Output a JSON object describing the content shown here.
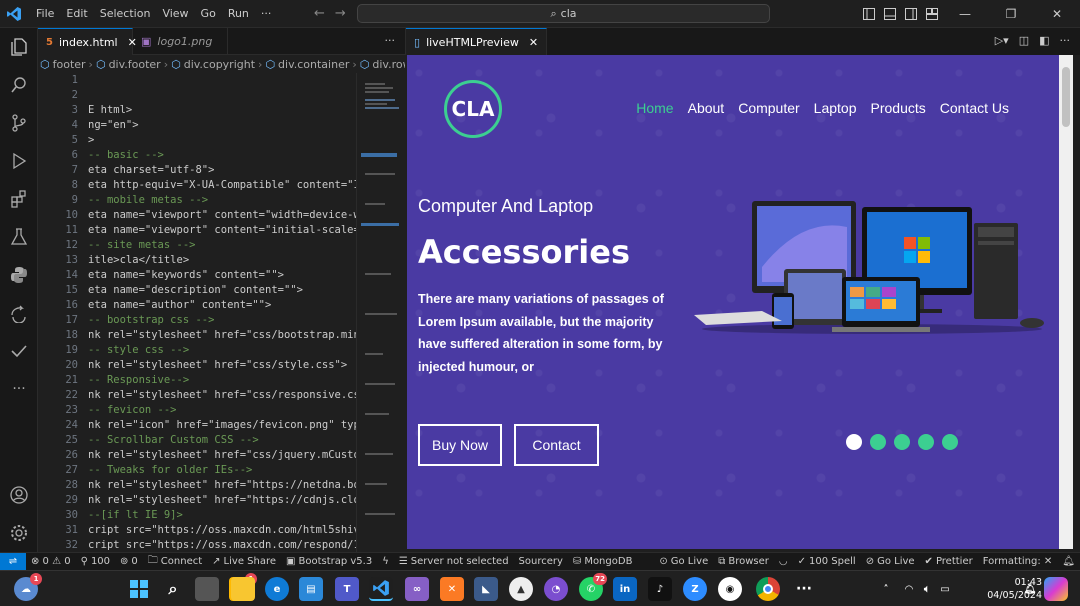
{
  "menu": [
    "File",
    "Edit",
    "Selection",
    "View",
    "Go",
    "Run",
    "···"
  ],
  "search": {
    "text": "cla"
  },
  "tabs_left": [
    {
      "label": "index.html",
      "active": true
    },
    {
      "label": "logo1.png",
      "active": false
    }
  ],
  "tabs_right": {
    "label": "liveHTMLPreview"
  },
  "breadcrumb": [
    "footer",
    "div.footer",
    "div.copyright",
    "div.container",
    "div.row"
  ],
  "lines": {
    "numbers": [
      "1",
      "2",
      "3",
      "4",
      "5",
      "6",
      "7",
      "8",
      "9",
      "10",
      "11",
      "12",
      "13",
      "14",
      "15",
      "16",
      "17",
      "18",
      "19",
      "20",
      "21",
      "22",
      "23",
      "24",
      "25",
      "26",
      "27",
      "28",
      "29",
      "30",
      "31",
      "32"
    ],
    "code": [
      "",
      "",
      "E html>",
      "ng=\"en\">",
      ">",
      "-- basic -->",
      "eta charset=\"utf-8\">",
      "eta http-equiv=\"X-UA-Compatible\" content=\"IE",
      "-- mobile metas -->",
      "eta name=\"viewport\" content=\"width=device-wi",
      "eta name=\"viewport\" content=\"initial-scale=1",
      "-- site metas -->",
      "itle>cla</title>",
      "eta name=\"keywords\" content=\"\">",
      "eta name=\"description\" content=\"\">",
      "eta name=\"author\" content=\"\">",
      "-- bootstrap css -->",
      "nk rel=\"stylesheet\" href=\"css/bootstrap.min",
      "-- style css -->",
      "nk rel=\"stylesheet\" href=\"css/style.css\">",
      "-- Responsive-->",
      "nk rel=\"stylesheet\" href=\"css/responsive.cs",
      "-- fevicon -->",
      "nk rel=\"icon\" href=\"images/fevicon.png\" typ",
      "-- Scrollbar Custom CSS -->",
      "nk rel=\"stylesheet\" href=\"css/jquery.mCusto",
      "-- Tweaks for older IEs-->",
      "nk rel=\"stylesheet\" href=\"https://netdna.bo",
      "nk rel=\"stylesheet\" href=\"https://cdnjs.clo",
      "--[if lt IE 9]>",
      "cript src=\"https://oss.maxcdn.com/html5shiv/",
      "cript src=\"https://oss.maxcdn.com/respond/1."
    ]
  },
  "site": {
    "logo": "CLA",
    "nav": [
      "Home",
      "About",
      "Computer",
      "Laptop",
      "Products",
      "Contact Us"
    ],
    "subtitle": "Computer And Laptop",
    "title": "Accessories",
    "text": "There are many variations of passages of Lorem Ipsum available, but the majority have suffered alteration in some form, by injected humour, or",
    "buy": "Buy Now",
    "contact": "Contact",
    "slides": 5,
    "active_slide": 1
  },
  "status": {
    "problems": "⊗ 0 ⚠ 0",
    "ports": "100",
    "zero": "0",
    "connect": "Connect",
    "liveshare": "Live Share",
    "bootstrap": "Bootstrap v5.3",
    "server": "Server not selected",
    "sourcery": "Sourcery",
    "mongo": "MongoDB",
    "golive1": "Go Live",
    "browser": "Browser",
    "spell": "100 Spell",
    "golive2": "Go Live",
    "prettier": "Prettier",
    "formatting": "Formatting: ✕"
  },
  "taskbar": {
    "time": "01:43",
    "date": "04/05/2024",
    "teams_badge": "1",
    "whatsapp_badge": "72",
    "weather_badge": "1"
  },
  "colors": {
    "accent": "#3ccf91",
    "hero_bg": "#4a3aa3",
    "vscode_blue": "#0078d4"
  }
}
